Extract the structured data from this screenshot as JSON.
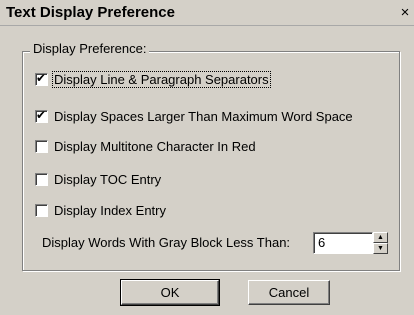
{
  "window": {
    "title": "Text Display Preference",
    "close_glyph": "×"
  },
  "group": {
    "legend": "Display Preference:"
  },
  "options": [
    {
      "label": "Display Line & Paragraph Separators",
      "checked": true
    },
    {
      "label": "Display Spaces Larger Than Maximum Word Space",
      "checked": true
    },
    {
      "label": "Display Multitone Character In Red",
      "checked": false
    },
    {
      "label": "Display TOC Entry",
      "checked": false
    },
    {
      "label": "Display Index Entry",
      "checked": false
    }
  ],
  "gray_block": {
    "label": "Display Words  With Gray Block Less Than:",
    "value": "6"
  },
  "buttons": {
    "ok": "OK",
    "cancel": "Cancel"
  },
  "icons": {
    "close": "close-icon",
    "check": "checkmark-icon",
    "spin_up": "spin-up-arrow-icon",
    "spin_down": "spin-down-arrow-icon"
  },
  "colors": {
    "dialog_face": "#d4d0c8",
    "shadow": "#808080",
    "highlight": "#ffffff"
  }
}
